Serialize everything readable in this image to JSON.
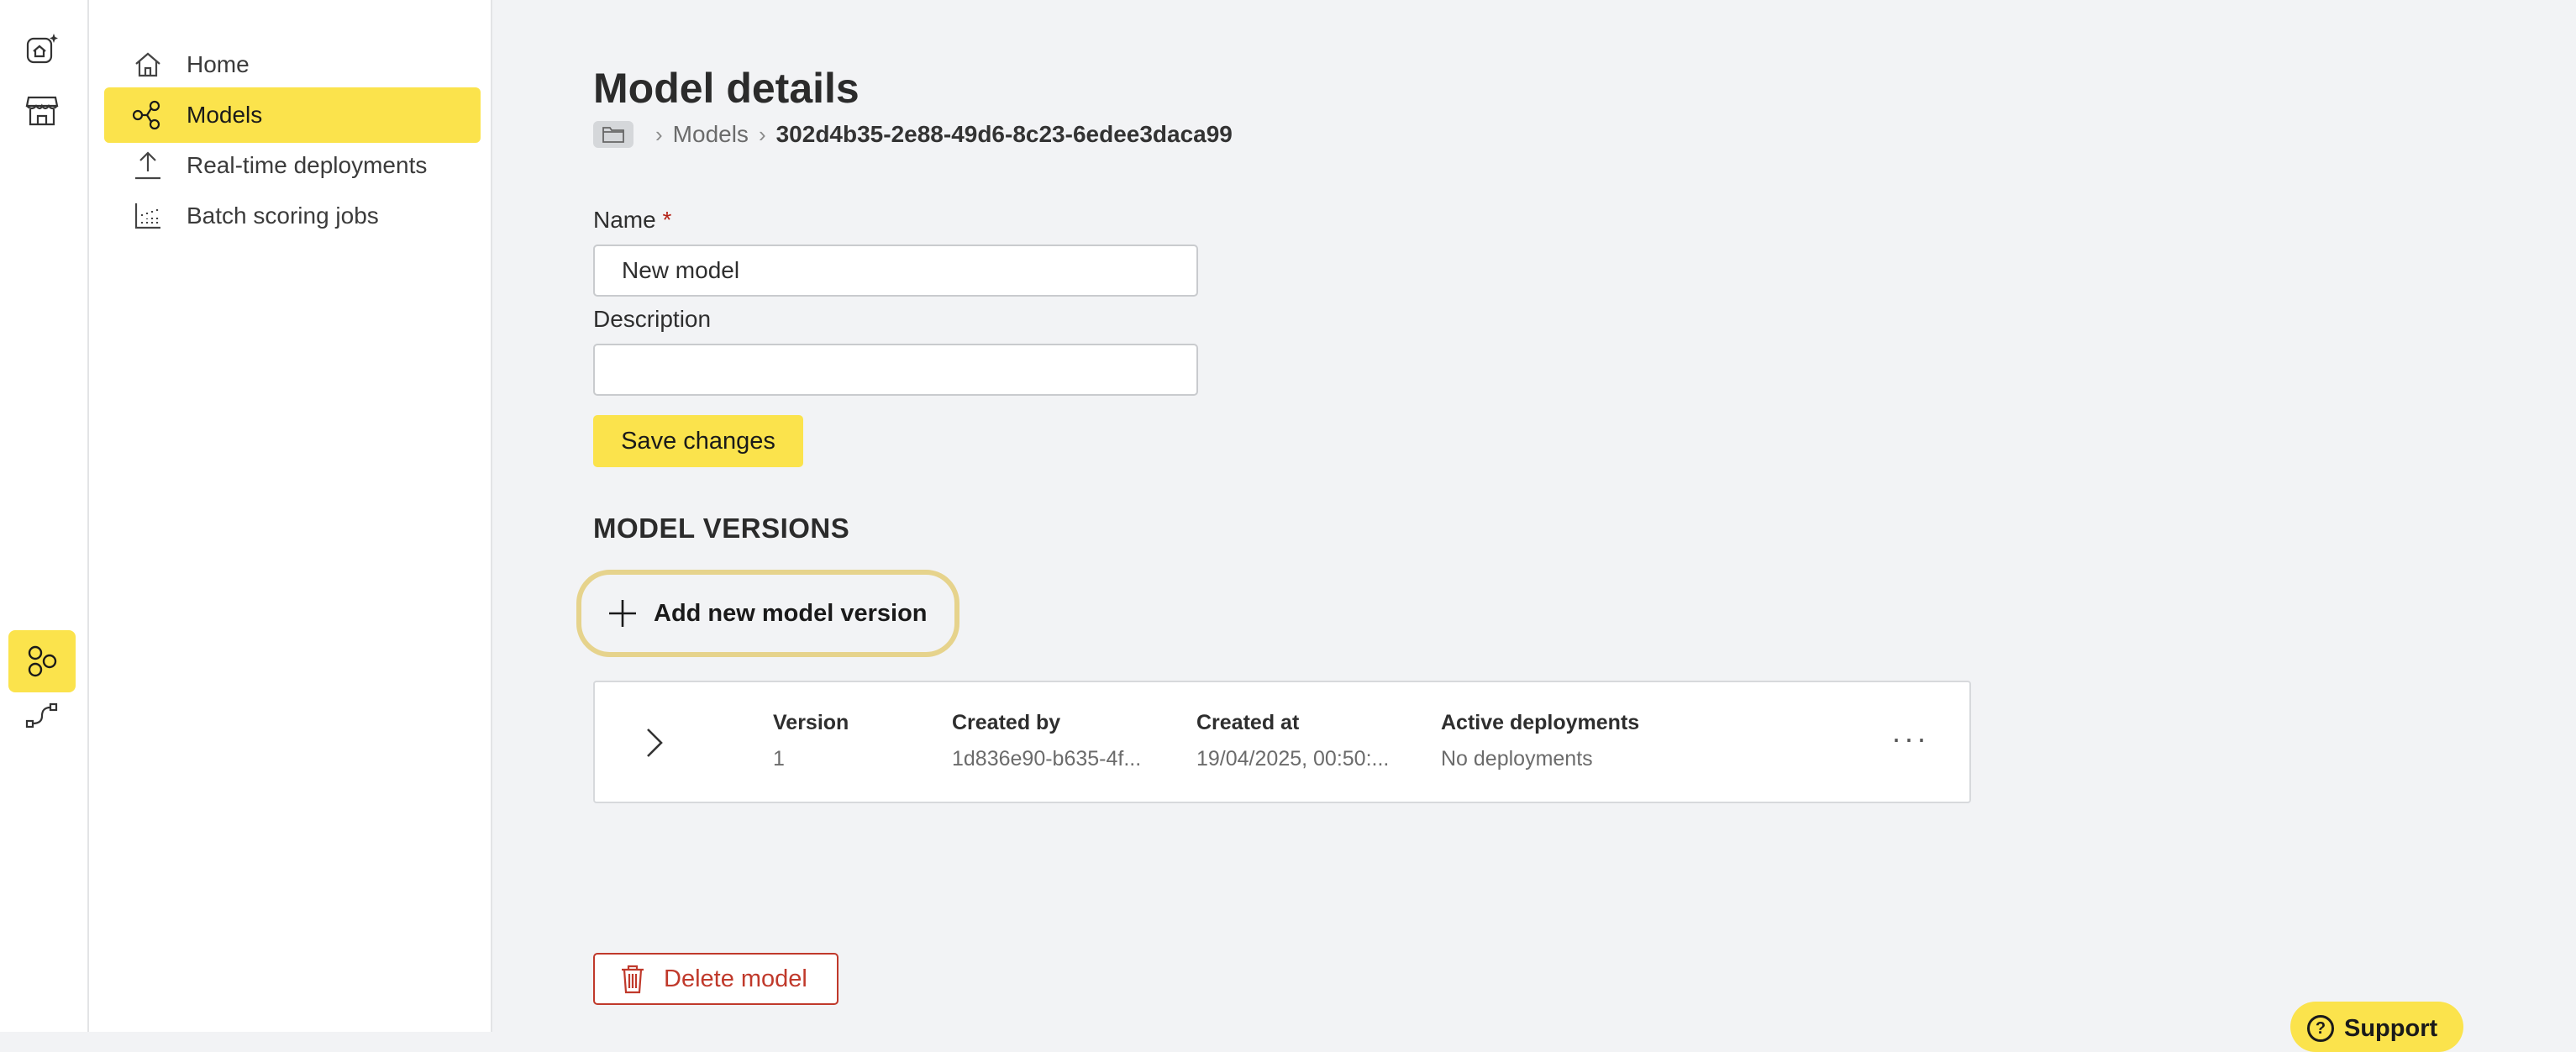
{
  "rail": {
    "icons": [
      "ai-home-icon",
      "store-icon",
      "models-hub-icon",
      "pipeline-icon"
    ]
  },
  "sidebar": {
    "items": [
      {
        "label": "Home",
        "icon": "home-icon"
      },
      {
        "label": "Models",
        "icon": "models-icon",
        "active": true
      },
      {
        "label": "Real-time deployments",
        "icon": "upload-icon"
      },
      {
        "label": "Batch scoring jobs",
        "icon": "batch-chart-icon"
      }
    ]
  },
  "main": {
    "title": "Model details",
    "breadcrumb": {
      "parent": "Models",
      "current": "302d4b35-2e88-49d6-8c23-6edee3daca99"
    },
    "form": {
      "name_label": "Name",
      "required_mark": "*",
      "name_value": "New model",
      "description_label": "Description",
      "description_value": "",
      "save_label": "Save changes"
    },
    "versions": {
      "section_title": "MODEL VERSIONS",
      "add_label": "Add new model version",
      "columns": [
        "Version",
        "Created by",
        "Created at",
        "Active deployments"
      ],
      "rows": [
        {
          "version": "1",
          "created_by": "1d836e90-b635-4f...",
          "created_at": "19/04/2025, 00:50:...",
          "deployments": "No deployments"
        }
      ],
      "more_label": "···"
    },
    "delete_label": "Delete model",
    "support_label": "Support"
  },
  "colors": {
    "accent": "#fbe34c",
    "danger": "#c0392b",
    "focus_ring": "#e6d38c"
  }
}
